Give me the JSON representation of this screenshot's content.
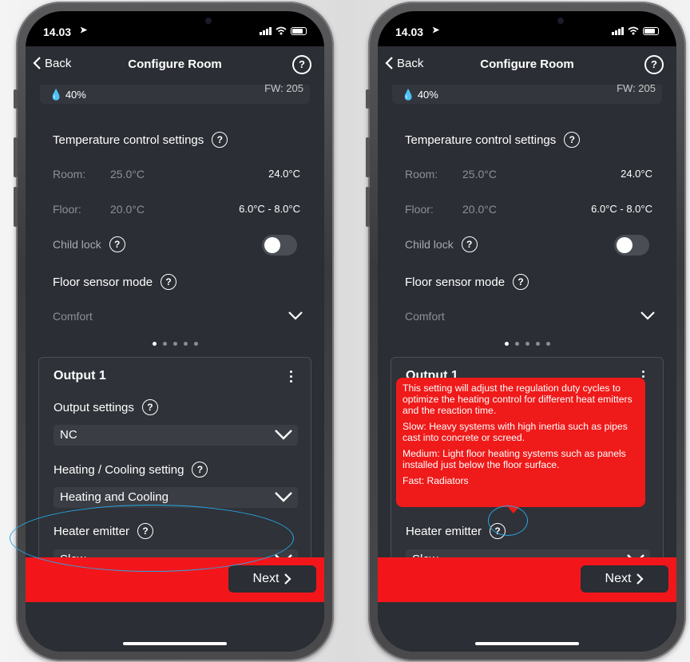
{
  "status": {
    "time": "14.03"
  },
  "nav": {
    "back_label": "Back",
    "title": "Configure Room",
    "help": "?"
  },
  "info": {
    "humidity": "40%",
    "firmware": "FW: 205"
  },
  "temp_settings": {
    "title": "Temperature control settings",
    "room_label": "Room:",
    "room_value": "25.0°C",
    "room_right": "24.0°C",
    "floor_label": "Floor:",
    "floor_value": "20.0°C",
    "floor_right": "6.0°C - 8.0°C"
  },
  "child_lock": {
    "label": "Child lock",
    "enabled": false
  },
  "floor_sensor": {
    "title": "Floor sensor mode",
    "value": "Comfort"
  },
  "pager": {
    "count": 5,
    "active": 1
  },
  "output": {
    "title": "Output 1",
    "settings_label": "Output settings",
    "settings_value": "NC",
    "heating_label": "Heating / Cooling setting",
    "heating_value": "Heating and Cooling",
    "emitter_label": "Heater emitter",
    "emitter_value": "Slow"
  },
  "next_label": "Next",
  "tooltip": {
    "p1": "This setting will adjust the regulation duty cycles to optimize the heating control for different heat emitters and the reaction time.",
    "p2": "Slow: Heavy systems with high inertia such as pipes cast into concrete or screed.",
    "p3": "Medium: Light floor heating systems such as panels installed just below the floor surface.",
    "p4": "Fast: Radiators"
  },
  "colors": {
    "accent_red": "#f2161b",
    "highlight_blue": "#27a8e6",
    "app_bg": "#2b2e34"
  }
}
